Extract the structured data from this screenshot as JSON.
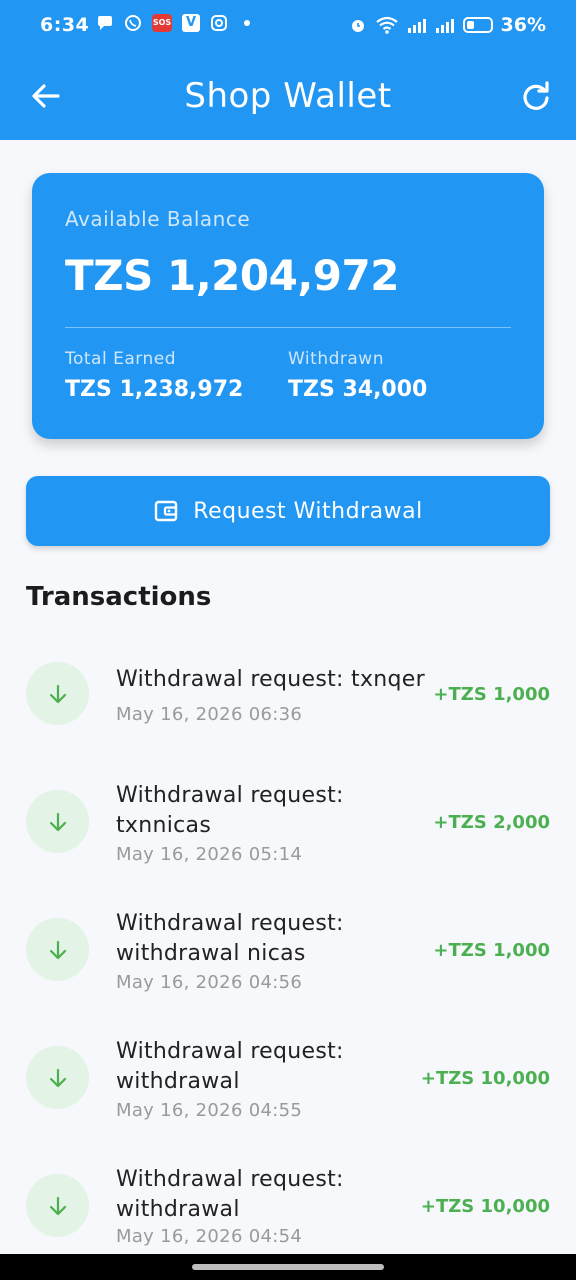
{
  "status_bar": {
    "time": "6:34",
    "sos_label": "SOS",
    "v_label": "V",
    "battery_percent": "36%",
    "battery_level": 0.36,
    "icons": [
      "message-icon",
      "whatsapp-icon",
      "sos-icon",
      "v-app-icon",
      "instagram-icon",
      "alarm-icon",
      "wifi-icon",
      "signal-icon",
      "battery-icon"
    ]
  },
  "app_bar": {
    "title": "Shop Wallet",
    "back_icon": "arrow-left-icon",
    "refresh_icon": "refresh-icon"
  },
  "balance_card": {
    "label": "Available Balance",
    "amount": "TZS 1,204,972",
    "total_earned_label": "Total Earned",
    "total_earned_value": "TZS 1,238,972",
    "withdrawn_label": "Withdrawn",
    "withdrawn_value": "TZS 34,000"
  },
  "withdraw_button": {
    "label": "Request Withdrawal",
    "icon": "wallet-icon"
  },
  "transactions": {
    "heading": "Transactions",
    "items": [
      {
        "title": "Withdrawal request: txnqer",
        "date": "May 16, 2026 06:36",
        "amount": "+TZS 1,000"
      },
      {
        "title": "Withdrawal request: txnnicas",
        "date": "May 16, 2026 05:14",
        "amount": "+TZS 2,000"
      },
      {
        "title": "Withdrawal request: withdrawal nicas",
        "date": "May 16, 2026 04:56",
        "amount": "+TZS 1,000"
      },
      {
        "title": "Withdrawal request: withdrawal",
        "date": "May 16, 2026 04:55",
        "amount": "+TZS 10,000"
      },
      {
        "title": "Withdrawal request: withdrawal",
        "date": "May 16, 2026 04:54",
        "amount": "+TZS 10,000"
      }
    ]
  },
  "colors": {
    "primary": "#2196f3",
    "positive": "#4caf50",
    "icon_circle_bg": "#e3f3e6",
    "background": "#f6f8fc"
  }
}
